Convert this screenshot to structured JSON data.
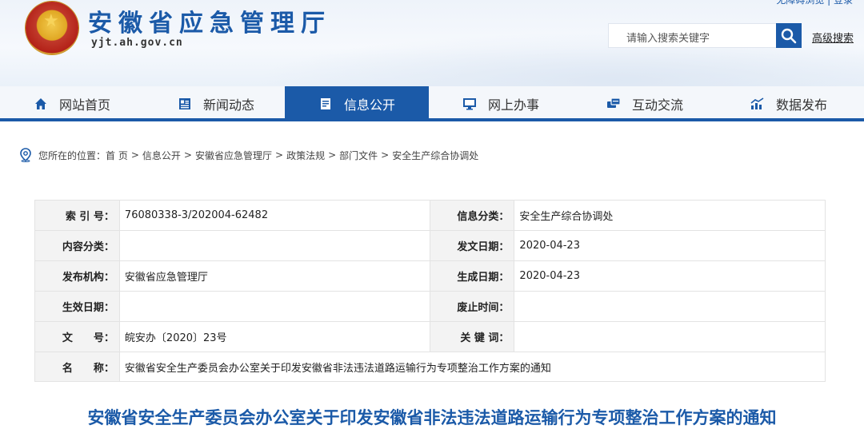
{
  "header": {
    "site_title": "安徽省应急管理厅",
    "domain": "yjt.ah.gov.cn",
    "top_links": "无障碍浏览 | 登录",
    "search_placeholder": "请输入搜索关键字",
    "advanced_search": "高级搜索"
  },
  "nav": {
    "items": [
      {
        "label": "网站首页",
        "icon": "home-icon"
      },
      {
        "label": "新闻动态",
        "icon": "news-icon"
      },
      {
        "label": "信息公开",
        "icon": "document-icon",
        "active": true
      },
      {
        "label": "网上办事",
        "icon": "monitor-icon"
      },
      {
        "label": "互动交流",
        "icon": "chat-icon"
      },
      {
        "label": "数据发布",
        "icon": "chart-icon"
      }
    ]
  },
  "breadcrumb": {
    "prefix": "您所在的位置：",
    "items": [
      "首 页",
      "信息公开",
      "安徽省应急管理厅",
      "政策法规",
      "部门文件",
      "安全生产综合协调处"
    ]
  },
  "info": {
    "index_no_label": "索 引 号：",
    "index_no": "76080338-3/202004-62482",
    "category_label": "信息分类：",
    "category": "安全生产综合协调处",
    "content_class_label": "内容分类：",
    "content_class": "",
    "issue_date_label": "发文日期：",
    "issue_date": "2020-04-23",
    "publisher_label": "发布机构：",
    "publisher": "安徽省应急管理厅",
    "generated_date_label": "生成日期：",
    "generated_date": "2020-04-23",
    "effective_date_label": "生效日期：",
    "effective_date": "",
    "expiry_date_label": "废止时间：",
    "expiry_date": "",
    "doc_no_label": "文　　号：",
    "doc_no": "皖安办〔2020〕23号",
    "keywords_label": "关 键 词：",
    "keywords": "",
    "name_label": "名　　称：",
    "name": "安徽省安全生产委员会办公室关于印发安徽省非法违法道路运输行为专项整治工作方案的通知"
  },
  "document": {
    "title": "安徽省安全生产委员会办公室关于印发安徽省非法违法道路运输行为专项整治工作方案的通知"
  },
  "colors": {
    "primary": "#1b5aa8",
    "label_bg": "#f3f3f3"
  }
}
